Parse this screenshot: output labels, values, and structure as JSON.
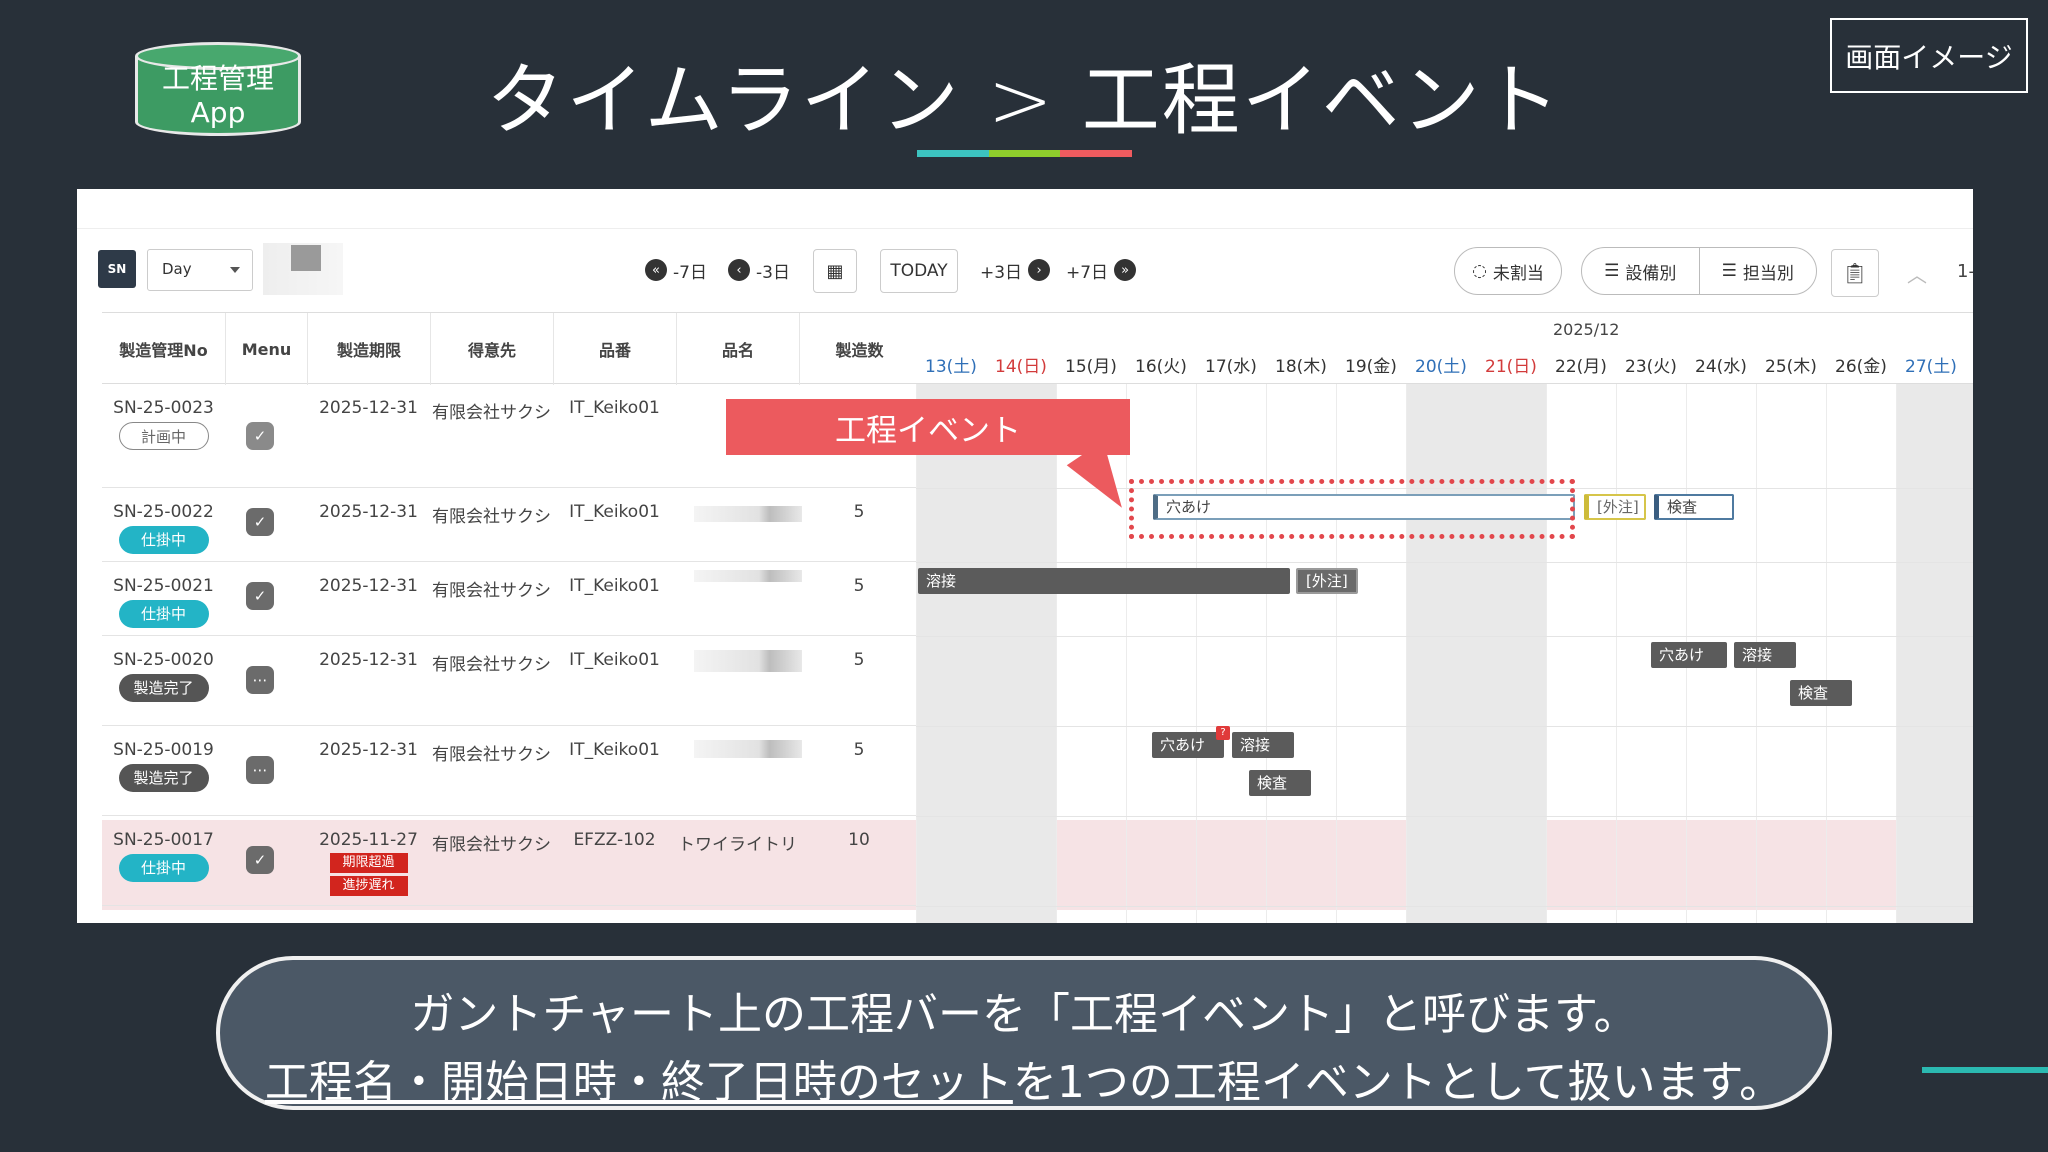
{
  "badge": {
    "line1": "工程管理",
    "line2": "App"
  },
  "slide_title": "タイムライン > 工程イベント",
  "image_tag": "画面イメージ",
  "accent_colors": [
    "#3cc3c0",
    "#8fce2c",
    "#ef5b5f"
  ],
  "toolbar": {
    "logo": "SN",
    "view_select": "Day",
    "nav": {
      "minus7": "-7日",
      "minus3": "-3日",
      "today": "TODAY",
      "plus3": "+3日",
      "plus7": "+7日"
    },
    "unassigned": "未割当",
    "by_equipment": "設備別",
    "by_person": "担当別",
    "page": "1-"
  },
  "table": {
    "headers": [
      "製造管理No",
      "Menu",
      "製造期限",
      "得意先",
      "品番",
      "品名",
      "製造数"
    ],
    "rows": [
      {
        "no": "SN-25-0023",
        "status": "計画中",
        "deadline": "2025-12-31",
        "customer": "有限会社サクシ",
        "part": "IT_Keiko01",
        "name": "",
        "qty": "",
        "tags": []
      },
      {
        "no": "SN-25-0022",
        "status": "仕掛中",
        "deadline": "2025-12-31",
        "customer": "有限会社サクシ",
        "part": "IT_Keiko01",
        "name": "",
        "qty": "5",
        "tags": []
      },
      {
        "no": "SN-25-0021",
        "status": "仕掛中",
        "deadline": "2025-12-31",
        "customer": "有限会社サクシ",
        "part": "IT_Keiko01",
        "name": "",
        "qty": "5",
        "tags": []
      },
      {
        "no": "SN-25-0020",
        "status": "製造完了",
        "deadline": "2025-12-31",
        "customer": "有限会社サクシ",
        "part": "IT_Keiko01",
        "name": "",
        "qty": "5",
        "tags": []
      },
      {
        "no": "SN-25-0019",
        "status": "製造完了",
        "deadline": "2025-12-31",
        "customer": "有限会社サクシ",
        "part": "IT_Keiko01",
        "name": "",
        "qty": "5",
        "tags": []
      },
      {
        "no": "SN-25-0017",
        "status": "仕掛中",
        "deadline": "2025-11-27",
        "customer": "有限会社サクシ",
        "part": "EFZZ-102",
        "name": "トワイライトリ",
        "qty": "10",
        "tags": [
          "期限超過",
          "進捗遅れ"
        ]
      }
    ]
  },
  "gantt": {
    "month": "2025/12",
    "days": [
      "13(土)",
      "14(日)",
      "15(月)",
      "16(火)",
      "17(水)",
      "18(木)",
      "19(金)",
      "20(土)",
      "21(日)",
      "22(月)",
      "23(火)",
      "24(水)",
      "25(木)",
      "26(金)",
      "27(土)"
    ],
    "events": {
      "r22_anake": "穴あけ",
      "r22_gaichu": "[外注]",
      "r22_kensa": "検査",
      "r21_yousetsu": "溶接",
      "r21_gaichu": "[外注]",
      "r20_anake": "穴あけ",
      "r20_yousetsu": "溶接",
      "r20_kensa": "検査",
      "r19_anake": "穴あけ",
      "r19_flag": "?",
      "r19_yousetsu": "溶接",
      "r19_kensa": "検査"
    }
  },
  "callout": "工程イベント",
  "caption": {
    "line1": "ガントチャート上の工程バーを「工程イベント」と呼びます。",
    "line2_underlined": "工程名・開始日時・終了日時のセット",
    "line2_rest": "を1つの工程イベントとして扱います。"
  }
}
